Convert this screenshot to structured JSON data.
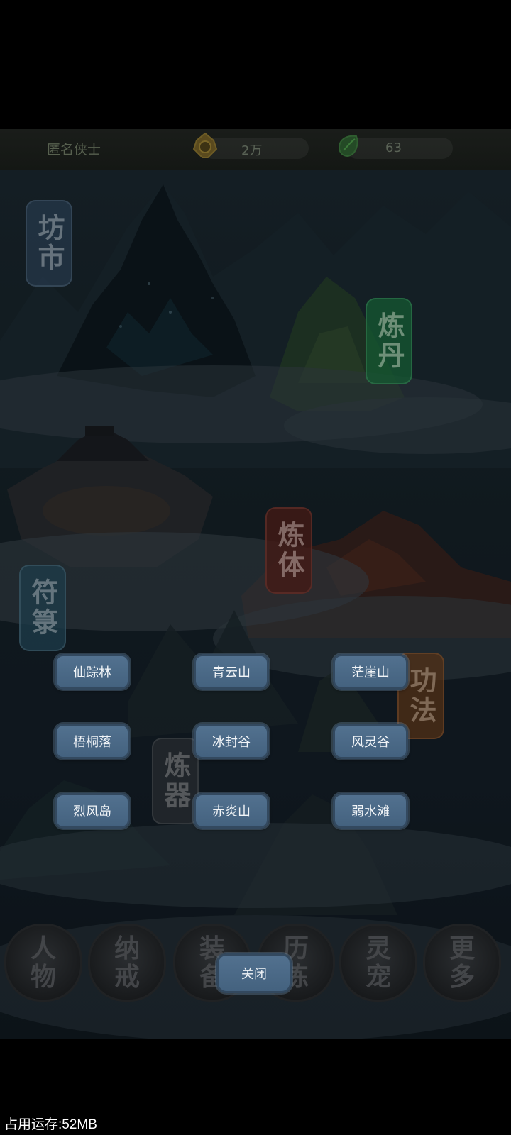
{
  "topbar": {
    "player_name": "匿名侠士",
    "gold_value": "2万",
    "jade_value": "63",
    "gold_icon": "gold-coin-icon",
    "jade_icon": "jade-leaf-icon"
  },
  "map_signs": [
    {
      "id": "market",
      "text": "坊市"
    },
    {
      "id": "alchemy",
      "text": "炼丹"
    },
    {
      "id": "body",
      "text": "炼体"
    },
    {
      "id": "talisman",
      "text": "符箓"
    },
    {
      "id": "technique",
      "text": "功法"
    },
    {
      "id": "forge",
      "text": "炼器"
    }
  ],
  "nav": [
    {
      "label": "人物"
    },
    {
      "label": "纳戒"
    },
    {
      "label": "装备"
    },
    {
      "label": "历练"
    },
    {
      "label": "灵宠"
    },
    {
      "label": "更多"
    }
  ],
  "locations": [
    "仙踪林",
    "青云山",
    "茫崖山",
    "梧桐落",
    "冰封谷",
    "风灵谷",
    "烈风岛",
    "赤炎山",
    "弱水滩"
  ],
  "close_label": "关闭",
  "status": {
    "memory_text": "占用运存:52MB"
  },
  "colors": {
    "button_fill": "#4b6a88",
    "button_border": "#33495f",
    "background": "#000000"
  }
}
